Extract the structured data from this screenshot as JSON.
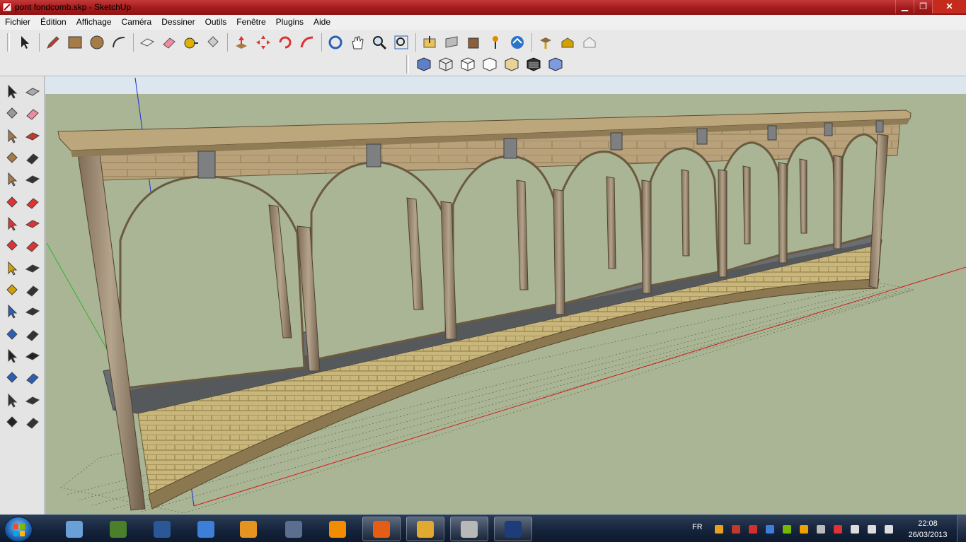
{
  "window": {
    "title": "pont fondcomb.skp - SketchUp",
    "minimize_glyph": "▁",
    "maximize_glyph": "❐",
    "close_glyph": "✕"
  },
  "menu": [
    "Fichier",
    "Édition",
    "Affichage",
    "Caméra",
    "Dessiner",
    "Outils",
    "Fenêtre",
    "Plugins",
    "Aide"
  ],
  "toolbar_row1": [
    "select-icon",
    "pencil-icon",
    "rectangle-icon",
    "circle-icon",
    "arc-icon",
    "make-component-icon",
    "eraser-icon",
    "tape-measure-icon",
    "paint-bucket-icon",
    "push-pull-icon",
    "move-icon",
    "rotate-icon",
    "follow-me-icon",
    "orbit-icon",
    "pan-icon",
    "zoom-icon",
    "zoom-extents-icon",
    "get-models-icon",
    "share-model-icon",
    "share-component-icon",
    "add-location-icon",
    "google-earth-icon",
    "get-photo-icon",
    "place-icon",
    "preview-icon"
  ],
  "toolbar_row2": [
    "xray-style-icon",
    "wireframe-style-icon",
    "hidden-line-style-icon",
    "shaded-style-icon",
    "shaded-textures-style-icon",
    "monochrome-style-icon",
    "back-edges-style-icon"
  ],
  "left_toolbar": [
    "select-icon",
    "make-component-icon",
    "paint-bucket-icon",
    "eraser-icon",
    "rectangle-icon",
    "line-icon",
    "circle-icon",
    "arc-icon",
    "polygon-icon",
    "freehand-icon",
    "move-icon",
    "push-pull-icon",
    "rotate-icon",
    "follow-me-icon",
    "scale-icon",
    "offset-icon",
    "tape-measure-icon",
    "dimension-icon",
    "protractor-icon",
    "text-icon",
    "axes-icon",
    "3d-text-icon",
    "orbit-icon",
    "pan-icon",
    "zoom-icon",
    "zoom-window-icon",
    "previous-view-icon",
    "zoom-extents-icon",
    "position-camera-icon",
    "look-around-icon",
    "walk-icon",
    "section-plane-icon"
  ],
  "colors": {
    "sky": "#dbe6ef",
    "ground": "#a9b594",
    "stone": "#b8a27a",
    "wall": "#c9b67a",
    "walkway": "#6a6e72",
    "axis_red": "#d31c1c",
    "axis_green": "#2db52d",
    "axis_blue": "#1a2fd6"
  },
  "taskbar": {
    "apps": [
      "start-orb",
      "sketchup-app",
      "calculator-app",
      "word-app",
      "explorer-app",
      "media-player-app",
      "xnview-app",
      "vlc-app",
      "firefox-app",
      "folder-app",
      "sketchup-app",
      "photoshop-app"
    ],
    "language": "FR",
    "time": "22:08",
    "date": "26/03/2013"
  }
}
